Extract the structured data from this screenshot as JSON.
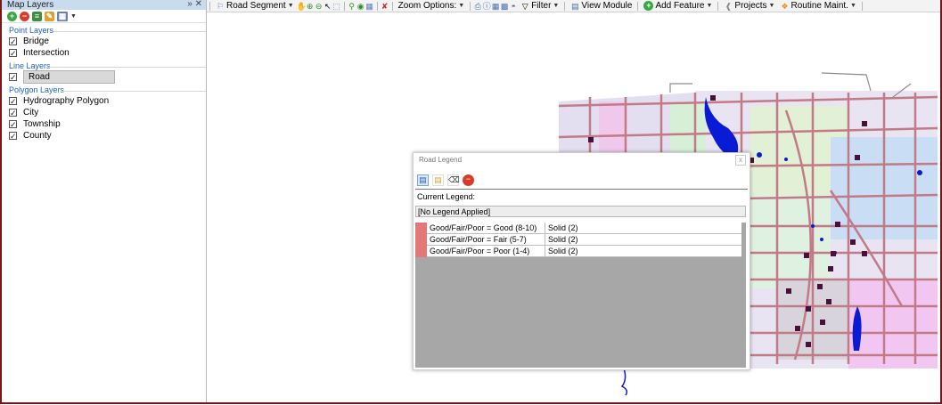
{
  "left_panel": {
    "title": "Map Layers",
    "pin_label": "» ✕",
    "groups": [
      {
        "label": "Point Layers",
        "layers": [
          {
            "label": "Bridge",
            "checked": true
          },
          {
            "label": "Intersection",
            "checked": true
          }
        ]
      },
      {
        "label": "Line Layers",
        "layers": [
          {
            "label": "Road",
            "checked": true
          }
        ]
      },
      {
        "label": "Polygon Layers",
        "layers": [
          {
            "label": "Hydrography Polygon",
            "checked": true
          },
          {
            "label": "City",
            "checked": true
          },
          {
            "label": "Township",
            "checked": true
          },
          {
            "label": "County",
            "checked": true
          }
        ]
      }
    ]
  },
  "toolbar": {
    "road_segment": "Road Segment",
    "zoom_options": "Zoom Options:",
    "filter": "Filter",
    "view_module": "View Module",
    "add_feature": "Add Feature",
    "projects": "Projects",
    "routine_maint": "Routine Maint."
  },
  "legend": {
    "title": "Road Legend",
    "close_glyph": "x",
    "current_label": "Current Legend:",
    "current_value": "[No Legend Applied]",
    "rows": [
      {
        "condition": "Good/Fair/Poor = Good (8-10)",
        "style": "Solid (2)"
      },
      {
        "condition": "Good/Fair/Poor = Fair (5-7)",
        "style": "Solid (2)"
      },
      {
        "condition": "Good/Fair/Poor = Poor (1-4)",
        "style": "Solid (2)"
      }
    ],
    "swatch_color": "#e27878"
  },
  "colors": {
    "road": "#c27a86",
    "water": "#0a1bd6",
    "marker": "#4a0f3a",
    "accent_border": "#7a1518"
  }
}
